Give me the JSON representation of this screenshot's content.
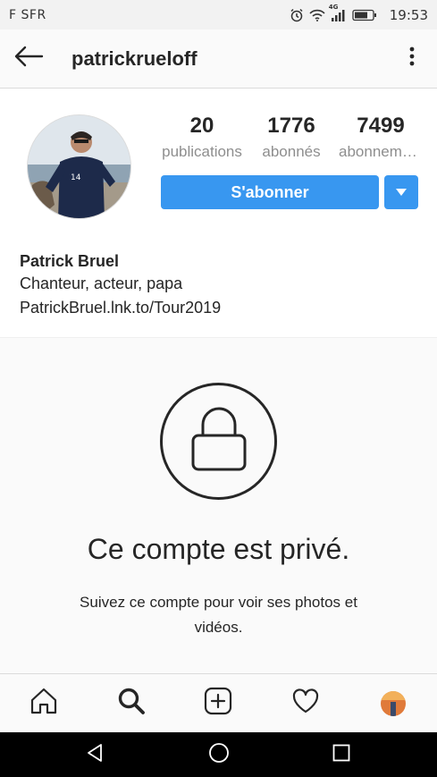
{
  "status_bar": {
    "carrier": "F SFR",
    "network": "4G",
    "time": "19:53"
  },
  "header": {
    "username": "patrickrueloff",
    "back_icon": "arrow-left-icon",
    "more_icon": "more-vertical-icon"
  },
  "profile": {
    "stats": [
      {
        "value": "20",
        "label": "publications"
      },
      {
        "value": "1776",
        "label": "abonnés"
      },
      {
        "value": "7499",
        "label": "abonnements"
      }
    ],
    "follow_label": "S'abonner",
    "dropdown_icon": "caret-down-icon"
  },
  "bio": {
    "name": "Patrick Bruel",
    "description": "Chanteur, acteur, papa",
    "link": "PatrickBruel.lnk.to/Tour2019"
  },
  "private_account": {
    "icon": "lock-icon",
    "title": "Ce compte est privé.",
    "description": "Suivez ce compte pour voir ses photos et vidéos."
  },
  "bottom_nav": [
    {
      "name": "home",
      "icon": "home-icon"
    },
    {
      "name": "search",
      "icon": "search-icon"
    },
    {
      "name": "new-post",
      "icon": "plus-square-icon"
    },
    {
      "name": "activity",
      "icon": "heart-icon"
    },
    {
      "name": "profile",
      "icon": "avatar"
    }
  ],
  "colors": {
    "accent": "#3897f0",
    "text": "#262626",
    "secondary_text": "#8e8e8e",
    "background": "#fafafa"
  }
}
